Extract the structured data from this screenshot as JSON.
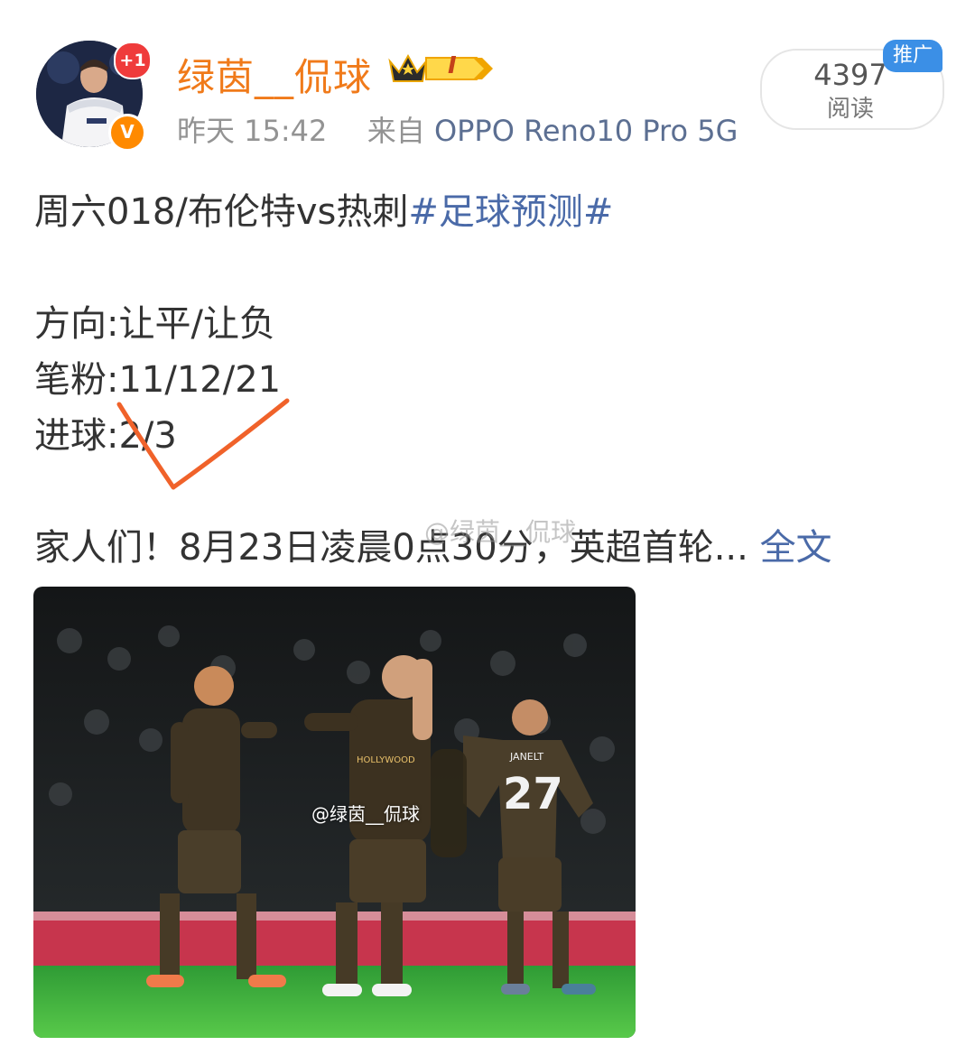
{
  "author": {
    "name": "绿茵__侃球",
    "plus_badge": "+1",
    "verified_badge": "V",
    "level_badge": "I"
  },
  "meta": {
    "time": "昨天 15:42",
    "source_prefix": "来自",
    "device": "OPPO Reno10 Pro 5G"
  },
  "reads": {
    "count": "4397",
    "label": "阅读",
    "promo_tag": "推广"
  },
  "post": {
    "title": "周六018/布伦特vs热刺",
    "hashtag": "#足球预测#",
    "direction": "方向:让平/让负",
    "pen_fans": "笔粉:11/12/21",
    "goals": "进球:2/3",
    "excerpt": "家人们！8月23日凌晨0点30分，英超首轮...",
    "more_link": "全文",
    "text_watermark": "@绿茵__侃球"
  },
  "image": {
    "watermark": "@绿茵__侃球",
    "shirt_number": "27",
    "shirt_name": "JANELT",
    "sponsor": "HOLLYWOOD"
  },
  "colors": {
    "username": "#f07a1a",
    "link": "#4a6aa8",
    "promo": "#3b8fe6",
    "check_mark": "#f0622a"
  }
}
